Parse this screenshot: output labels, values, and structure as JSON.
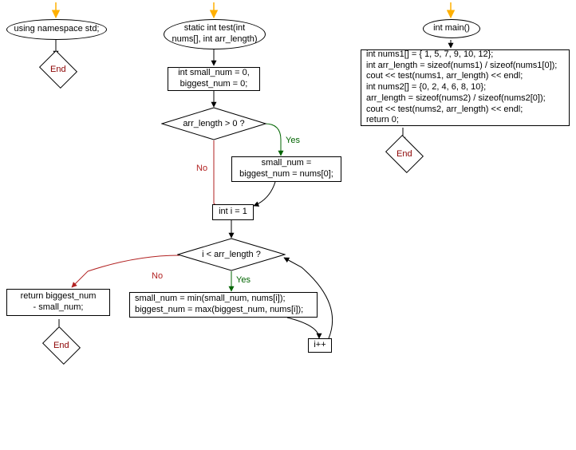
{
  "col1": {
    "entry_arrow": true,
    "start": "using namespace std;",
    "end": "End"
  },
  "col2": {
    "entry_arrow": true,
    "start": "static int test(int\nnums[], int arr_length)",
    "init": "int small_num = 0,\nbiggest_num = 0;",
    "cond1": "arr_length > 0 ?",
    "cond1_yes": "Yes",
    "cond1_no": "No",
    "assign1": "small_num =\nbiggest_num = nums[0];",
    "i_init": "int i = 1",
    "cond2": "i < arr_length ?",
    "cond2_yes": "Yes",
    "cond2_no": "No",
    "loop_body": "small_num = min(small_num, nums[i]);\nbiggest_num = max(biggest_num, nums[i]);",
    "inc": "i++",
    "ret": "return biggest_num\n- small_num;",
    "end": "End"
  },
  "col3": {
    "entry_arrow": true,
    "start": "int main()",
    "body": "int nums1[] = { 1, 5, 7, 9, 10, 12};\nint arr_length = sizeof(nums1) / sizeof(nums1[0]);\ncout << test(nums1, arr_length) << endl;\nint nums2[] = {0, 2, 4, 6, 8, 10};\narr_length = sizeof(nums2) / sizeof(nums2[0]);\ncout << test(nums2, arr_length) << endl;\nreturn 0;",
    "end": "End"
  },
  "colors": {
    "entry_arrow": "#ffb000",
    "yes_edge": "#006400",
    "no_edge": "#b22222",
    "normal_edge": "#000000",
    "end_text": "#8b0000"
  }
}
